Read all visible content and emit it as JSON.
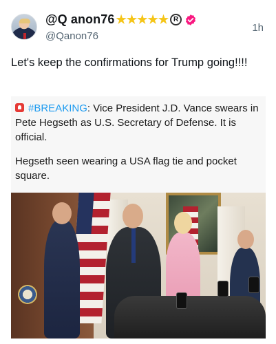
{
  "tweet": {
    "display_name": "@Q anon76",
    "stars": [
      "★",
      "★",
      "★",
      "★",
      "★"
    ],
    "registered_mark": "R",
    "handle": "@Qanon76",
    "time": "1h",
    "text": "Let's keep the confirmations for Trump going!!!!"
  },
  "quote": {
    "hashtag": "#BREAKING",
    "headline": ": Vice President J.D. Vance swears in Pete Hegseth as U.S. Secretary of Defense. It is official.",
    "paragraph2": "Hegseth seen wearing a USA flag tie and pocket square."
  },
  "icons": {
    "verified": "verified-badge-icon",
    "siren": "siren-icon",
    "verified_color": "#f91880",
    "hashtag_color": "#1d9bf0"
  }
}
